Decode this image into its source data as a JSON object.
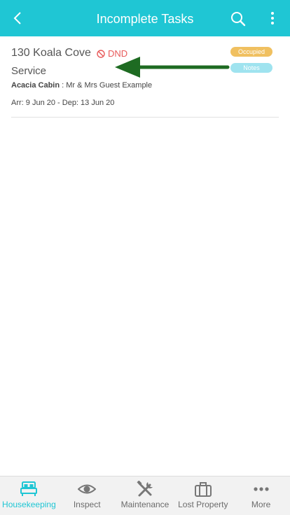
{
  "header": {
    "title": "Incomplete Tasks",
    "back_icon": "back-chevron-icon",
    "search_icon": "search-icon",
    "menu_icon": "kebab-menu-icon",
    "color": "#1fc6d4"
  },
  "task": {
    "room": "130 Koala Cove",
    "dnd": "DND",
    "status": "Service",
    "room_type": "Acacia Cabin",
    "guest": " : Mr & Mrs Guest Example",
    "dates": "Arr: 9 Jun 20 - Dep: 13 Jun 20",
    "badges": {
      "occupied": "Occupied",
      "notes": "Notes"
    }
  },
  "nav": {
    "items": [
      {
        "label": "Housekeeping",
        "icon": "bed-icon",
        "active": true
      },
      {
        "label": "Inspect",
        "icon": "eye-icon",
        "active": false
      },
      {
        "label": "Maintenance",
        "icon": "tools-icon",
        "active": false
      },
      {
        "label": "Lost Property",
        "icon": "briefcase-icon",
        "active": false
      },
      {
        "label": "More",
        "icon": "more-dots-icon",
        "active": false
      }
    ]
  }
}
